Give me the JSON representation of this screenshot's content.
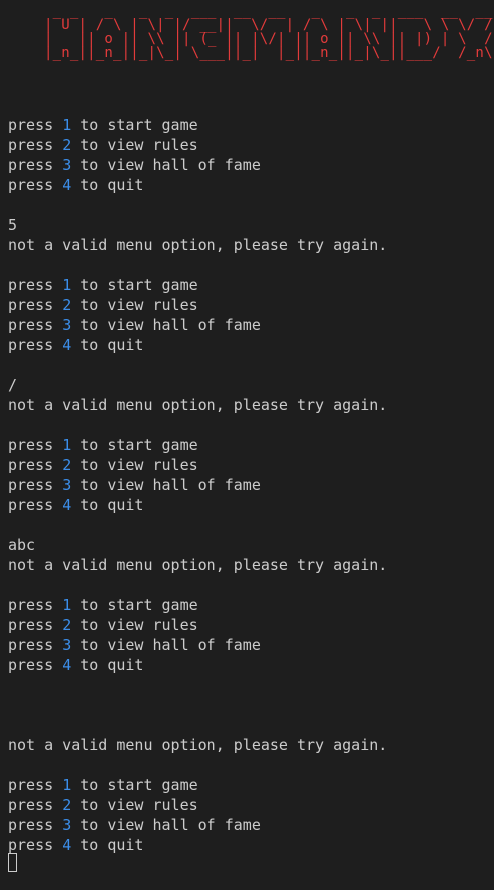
{
  "banner": {
    "ascii": " _ _   _   _  _  ___  __  __   _   _  _  ___  __  __\n| U | / \\ | \\| |/ __||  \\/  | / \\ | \\| ||   \\ \\ \\/ /\n|   || o || \\\\ || (_ || |\\/| || o || \\\\ || |) | \\  / \n|_n_||_n_||_|\\_| \\___||_|  |_||_n_||_|\\_||___/  /_n\\ "
  },
  "transcript": [
    {
      "kind": "menu",
      "items": [
        {
          "prefix": "press ",
          "key": "1",
          "suffix": " to start game"
        },
        {
          "prefix": "press ",
          "key": "2",
          "suffix": " to view rules"
        },
        {
          "prefix": "press ",
          "key": "3",
          "suffix": " to view hall of fame"
        },
        {
          "prefix": "press ",
          "key": "4",
          "suffix": " to quit"
        }
      ]
    },
    {
      "kind": "input",
      "text": "5"
    },
    {
      "kind": "error",
      "text": "not a valid menu option, please try again."
    },
    {
      "kind": "menu",
      "items": [
        {
          "prefix": "press ",
          "key": "1",
          "suffix": " to start game"
        },
        {
          "prefix": "press ",
          "key": "2",
          "suffix": " to view rules"
        },
        {
          "prefix": "press ",
          "key": "3",
          "suffix": " to view hall of fame"
        },
        {
          "prefix": "press ",
          "key": "4",
          "suffix": " to quit"
        }
      ]
    },
    {
      "kind": "input",
      "text": "/"
    },
    {
      "kind": "error",
      "text": "not a valid menu option, please try again."
    },
    {
      "kind": "menu",
      "items": [
        {
          "prefix": "press ",
          "key": "1",
          "suffix": " to start game"
        },
        {
          "prefix": "press ",
          "key": "2",
          "suffix": " to view rules"
        },
        {
          "prefix": "press ",
          "key": "3",
          "suffix": " to view hall of fame"
        },
        {
          "prefix": "press ",
          "key": "4",
          "suffix": " to quit"
        }
      ]
    },
    {
      "kind": "input",
      "text": "abc"
    },
    {
      "kind": "error",
      "text": "not a valid menu option, please try again."
    },
    {
      "kind": "menu",
      "items": [
        {
          "prefix": "press ",
          "key": "1",
          "suffix": " to start game"
        },
        {
          "prefix": "press ",
          "key": "2",
          "suffix": " to view rules"
        },
        {
          "prefix": "press ",
          "key": "3",
          "suffix": " to view hall of fame"
        },
        {
          "prefix": "press ",
          "key": "4",
          "suffix": " to quit"
        }
      ]
    },
    {
      "kind": "input",
      "text": ""
    },
    {
      "kind": "error",
      "text": "not a valid menu option, please try again."
    },
    {
      "kind": "menu",
      "items": [
        {
          "prefix": "press ",
          "key": "1",
          "suffix": " to start game"
        },
        {
          "prefix": "press ",
          "key": "2",
          "suffix": " to view rules"
        },
        {
          "prefix": "press ",
          "key": "3",
          "suffix": " to view hall of fame"
        },
        {
          "prefix": "press ",
          "key": "4",
          "suffix": " to quit"
        }
      ]
    }
  ],
  "colors": {
    "background": "#1e1e1e",
    "text": "#cccccc",
    "banner": "#e23b3b",
    "menu_key": "#3b8eea"
  }
}
